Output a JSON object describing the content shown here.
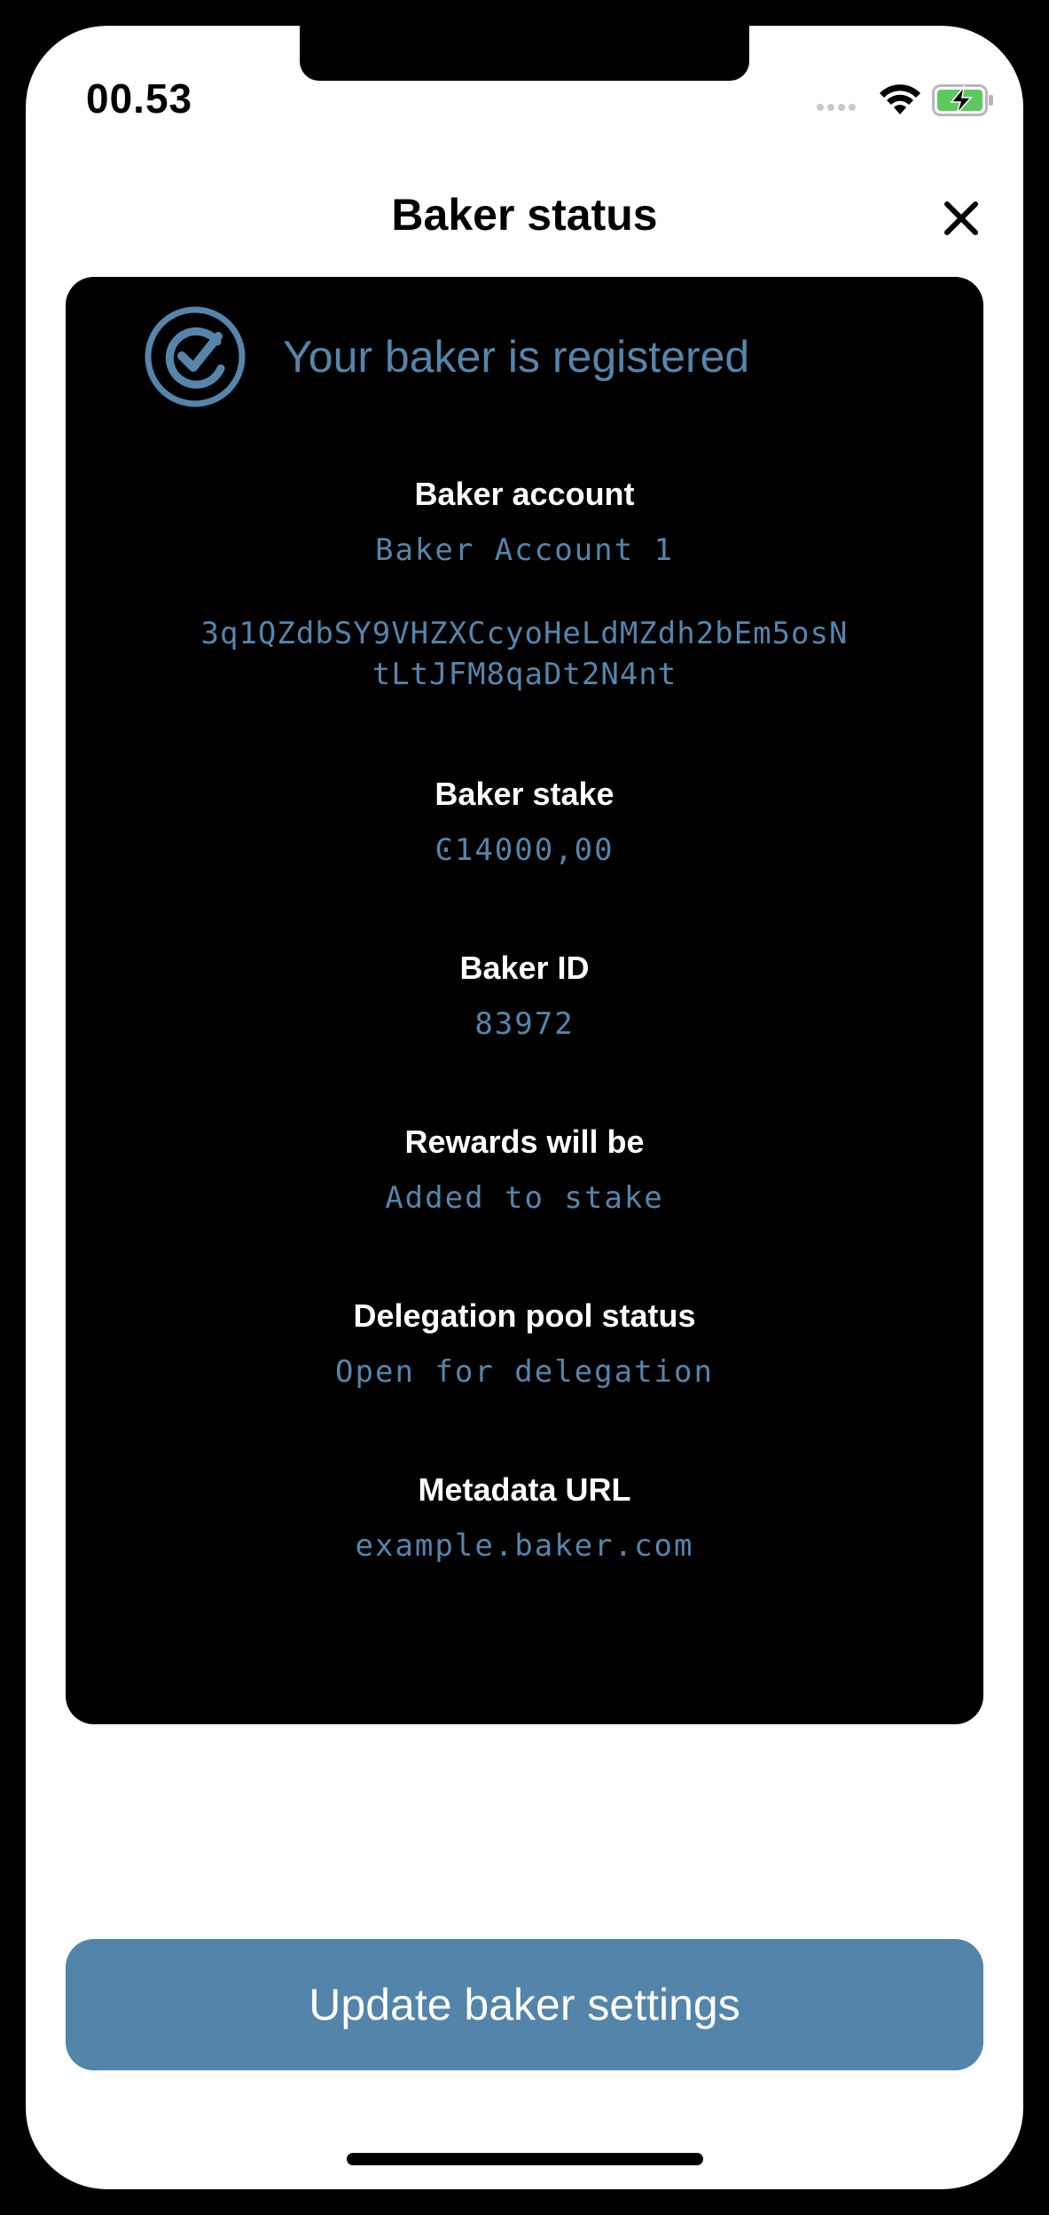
{
  "status_bar": {
    "time": "00.53"
  },
  "nav": {
    "title": "Baker status"
  },
  "card": {
    "title": "Your baker is registered",
    "baker_account": {
      "label": "Baker account",
      "name": "Baker Account 1",
      "address_line1": "3q1QZdbSY9VHZXCcyoHeLdMZdh2bEm5osN",
      "address_line2": "tLtJFM8qaDt2N4nt"
    },
    "baker_stake": {
      "label": "Baker stake",
      "value": "Ͼ14000,00"
    },
    "baker_id": {
      "label": "Baker ID",
      "value": "83972"
    },
    "rewards": {
      "label": "Rewards will be",
      "value": "Added to stake"
    },
    "pool_status": {
      "label": "Delegation pool status",
      "value": "Open for delegation"
    },
    "metadata_url": {
      "label": "Metadata URL",
      "value": "example.baker.com"
    }
  },
  "actions": {
    "update_label": "Update baker settings"
  },
  "colors": {
    "accent": "#5585ab",
    "button": "#5384aa",
    "card_bg": "#000000",
    "battery_fill": "#5ec95e"
  },
  "icons": {
    "close": "close-icon",
    "status": "check-circle-icon",
    "wifi": "wifi-icon",
    "battery": "battery-charging-icon"
  }
}
